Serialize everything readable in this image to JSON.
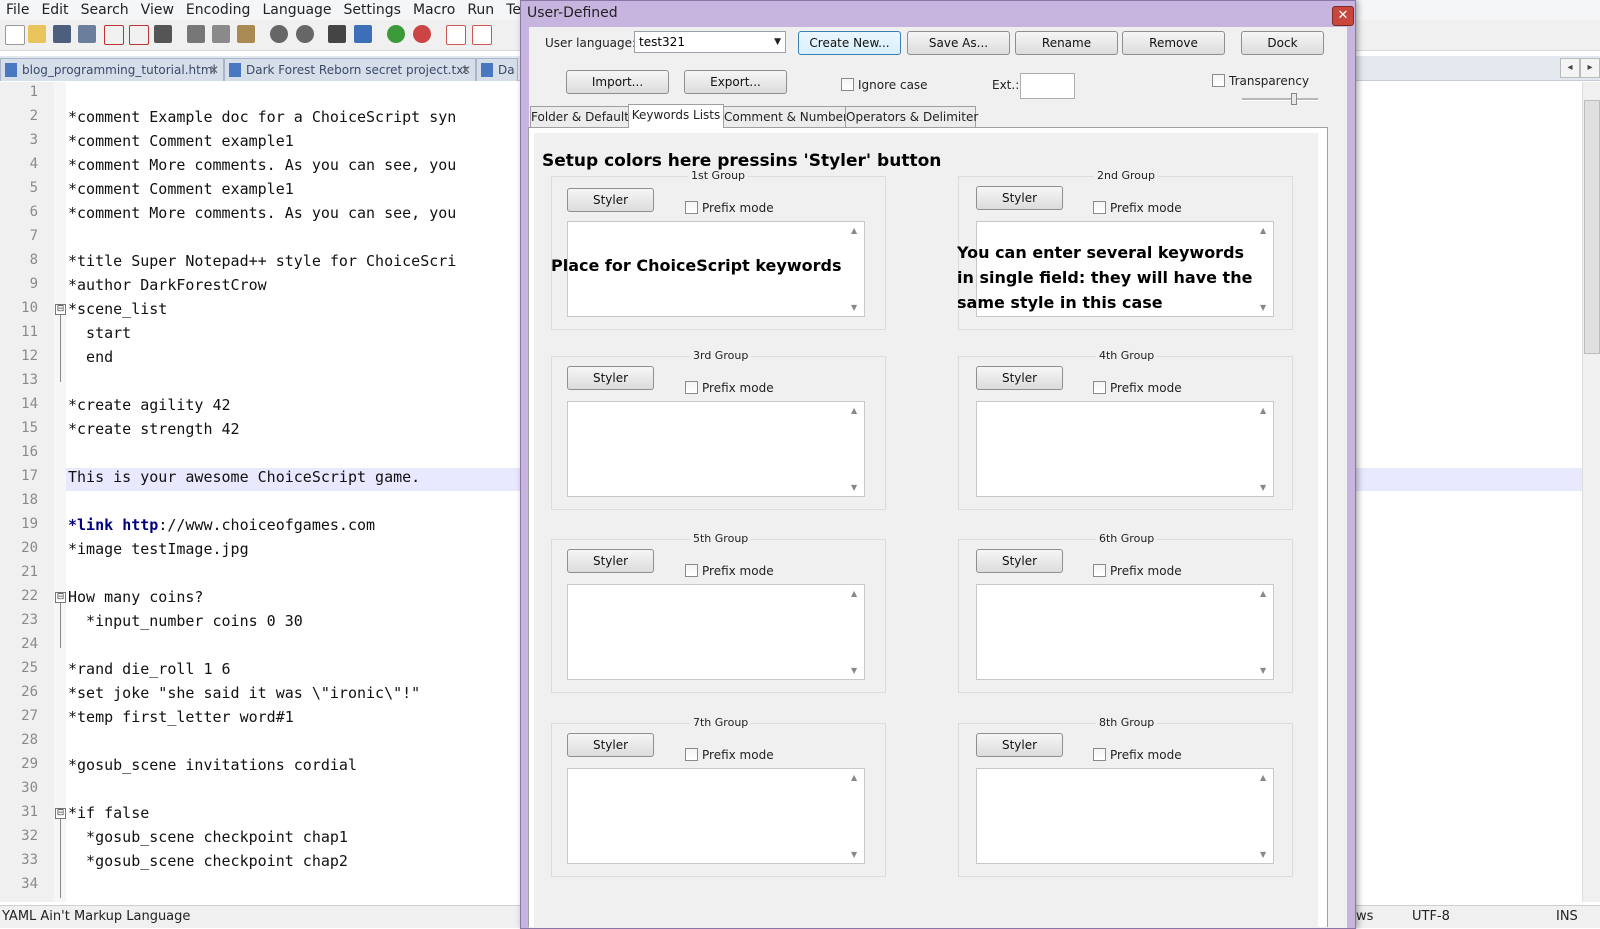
{
  "app": {
    "menu": [
      "File",
      "Edit",
      "Search",
      "View",
      "Encoding",
      "Language",
      "Settings",
      "Macro",
      "Run",
      "TextF"
    ],
    "tabs": [
      {
        "label": "blog_programming_tutorial.html",
        "close": "✕"
      },
      {
        "label": "Dark Forest Reborn secret project.txt",
        "close": "✕"
      },
      {
        "label": "Da"
      }
    ],
    "tab_nav_left": "◂",
    "tab_nav_right": "▸"
  },
  "editor": {
    "line_numbers": [
      "1",
      "2",
      "3",
      "4",
      "5",
      "6",
      "7",
      "8",
      "9",
      "10",
      "11",
      "12",
      "13",
      "14",
      "15",
      "16",
      "17",
      "18",
      "19",
      "20",
      "21",
      "22",
      "23",
      "24",
      "25",
      "26",
      "27",
      "28",
      "29",
      "30",
      "31",
      "32",
      "33",
      "34"
    ],
    "lines": [
      "",
      "*comment Example doc for a ChoiceScript syn",
      "*comment Comment example1",
      "*comment More comments. As you can see, you",
      "*comment Comment example1",
      "*comment More comments. As you can see, you",
      "",
      "*title Super Notepad++ style for ChoiceScri",
      "*author DarkForestCrow",
      "*scene_list",
      "  start",
      "  end",
      "",
      "*create agility 42",
      "*create strength 42",
      "",
      "This is your awesome ChoiceScript game.",
      "",
      "",
      "*image testImage.jpg",
      "",
      "How many coins?",
      "  *input_number coins 0 30",
      "",
      "*rand die_roll 1 6",
      "*set joke \"she said it was \\\"ironic\\\"!\"",
      "*temp first_letter word#1",
      "",
      "*gosub_scene invitations cordial",
      "",
      "*if false",
      "  *gosub_scene checkpoint chap1",
      "  *gosub_scene checkpoint chap2",
      ""
    ],
    "line19": {
      "kw1": "*link",
      "kw2": "http",
      "rest": "://www.choiceofgames.com"
    },
    "fold_markers": [
      "⊟",
      "⊟",
      "⊟"
    ]
  },
  "status": {
    "language": "YAML Ain't Markup Language",
    "eol": "ws",
    "encoding": "UTF-8",
    "mode": "INS"
  },
  "dialog": {
    "title": "User-Defined",
    "close": "✕",
    "user_language_label": "User language:",
    "user_language_value": "test321",
    "buttons": {
      "create_new": "Create New...",
      "save_as": "Save As...",
      "rename": "Rename",
      "remove": "Remove",
      "dock": "Dock",
      "import": "Import...",
      "export": "Export..."
    },
    "ignore_case": "Ignore case",
    "ext_label": "Ext.:",
    "transparency": "Transparency",
    "tabs": [
      "Folder & Default",
      "Keywords Lists",
      "Comment & Number",
      "Operators & Delimiter"
    ],
    "active_tab": "Keywords Lists",
    "groups": [
      {
        "title": "1st Group",
        "styler": "Styler",
        "prefix": "Prefix mode"
      },
      {
        "title": "2nd Group",
        "styler": "Styler",
        "prefix": "Prefix mode"
      },
      {
        "title": "3rd Group",
        "styler": "Styler",
        "prefix": "Prefix mode"
      },
      {
        "title": "4th Group",
        "styler": "Styler",
        "prefix": "Prefix mode"
      },
      {
        "title": "5th Group",
        "styler": "Styler",
        "prefix": "Prefix mode"
      },
      {
        "title": "6th Group",
        "styler": "Styler",
        "prefix": "Prefix mode"
      },
      {
        "title": "7th Group",
        "styler": "Styler",
        "prefix": "Prefix mode"
      },
      {
        "title": "8th Group",
        "styler": "Styler",
        "prefix": "Prefix mode"
      }
    ],
    "annotations": {
      "setup": "Setup colors here pressins 'Styler' button",
      "place": "Place for ChoiceScript keywords",
      "several_1": "You can enter several keywords",
      "several_2": "in single field: they will have the",
      "several_3": "same style in this case"
    }
  }
}
